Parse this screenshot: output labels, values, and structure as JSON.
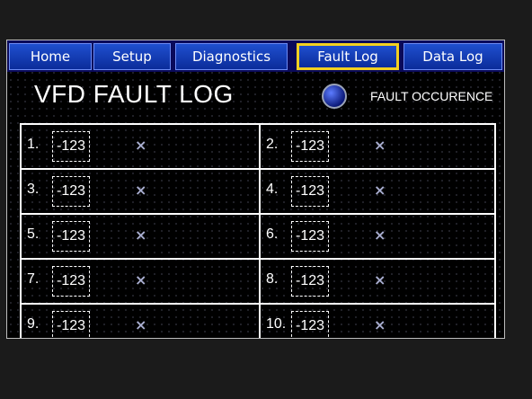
{
  "tabs": [
    {
      "label": "Home",
      "active": false
    },
    {
      "label": "Setup",
      "active": false
    },
    {
      "label": "Diagnostics",
      "active": false
    },
    {
      "label": "Fault Log",
      "active": true
    },
    {
      "label": "Data Log",
      "active": false
    }
  ],
  "page": {
    "title": "VFD FAULT LOG"
  },
  "indicator": {
    "label": "FAULT OCCURENCE",
    "icon": "status-led-icon"
  },
  "faults": [
    {
      "index": "1.",
      "code": "-123",
      "mark": "×"
    },
    {
      "index": "2.",
      "code": "-123",
      "mark": "×"
    },
    {
      "index": "3.",
      "code": "-123",
      "mark": "×"
    },
    {
      "index": "4.",
      "code": "-123",
      "mark": "×"
    },
    {
      "index": "5.",
      "code": "-123",
      "mark": "×"
    },
    {
      "index": "6.",
      "code": "-123",
      "mark": "×"
    },
    {
      "index": "7.",
      "code": "-123",
      "mark": "×"
    },
    {
      "index": "8.",
      "code": "-123",
      "mark": "×"
    },
    {
      "index": "9.",
      "code": "-123",
      "mark": "×"
    },
    {
      "index": "10.",
      "code": "-123",
      "mark": "×"
    }
  ],
  "colors": {
    "tab_fill": "#1f4fcf",
    "tab_active_border": "#f3d020",
    "screen_bg": "#000000",
    "led": "#2a4ad8"
  }
}
